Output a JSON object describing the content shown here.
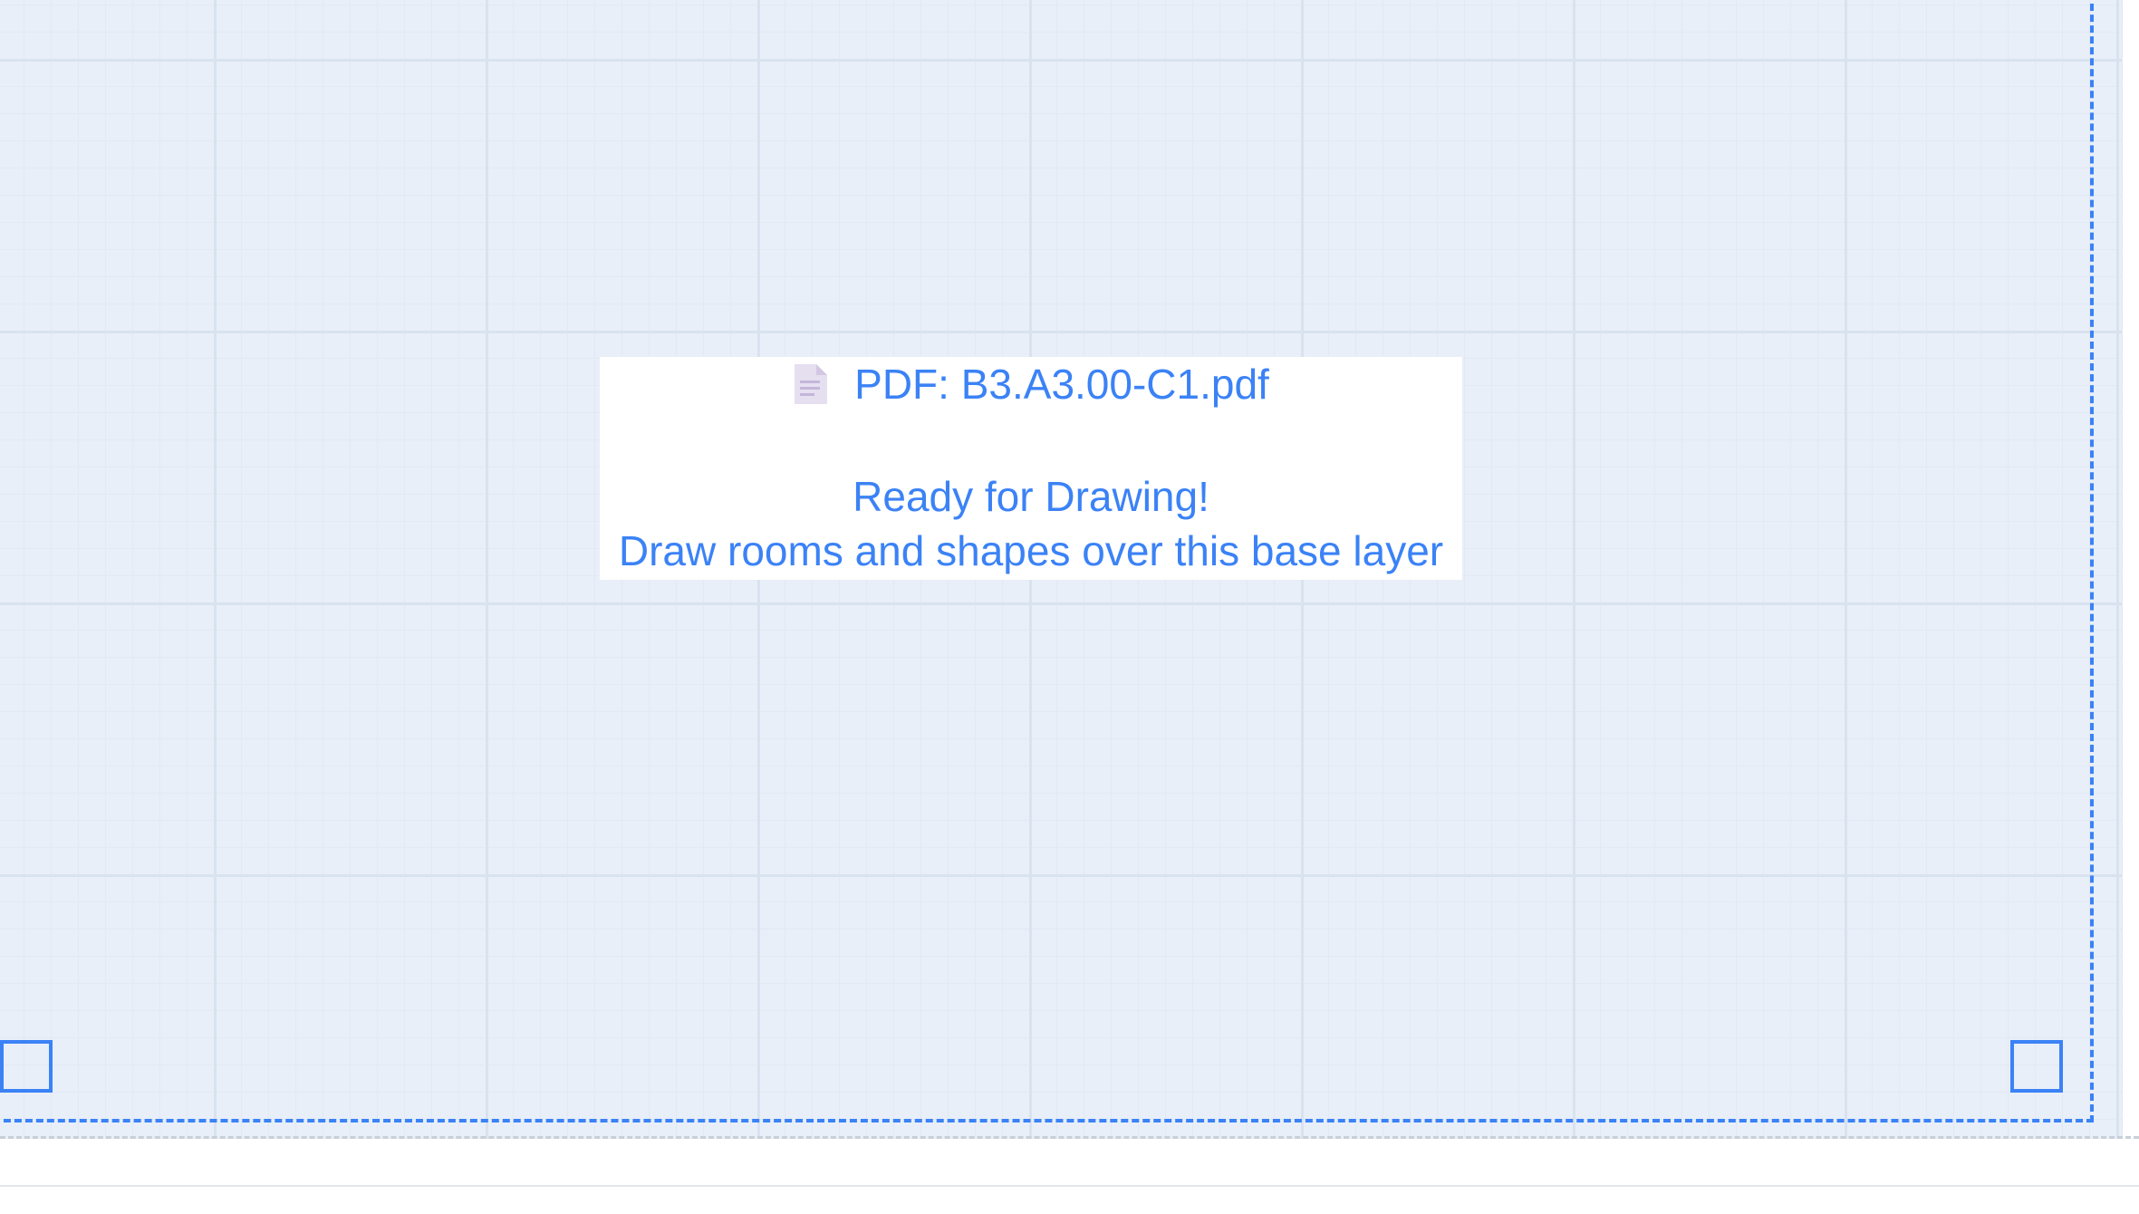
{
  "canvas": {
    "background_color": "#e8eff9",
    "grid_color": "#d9e2ef",
    "frame_color": "#3b82f6"
  },
  "info_box": {
    "icon": "document-icon",
    "title": "PDF: B3.A3.00-C1.pdf",
    "ready_text": "Ready for Drawing!",
    "instruction_text": "Draw rooms and shapes over this base layer",
    "text_color": "#3b82f6"
  }
}
